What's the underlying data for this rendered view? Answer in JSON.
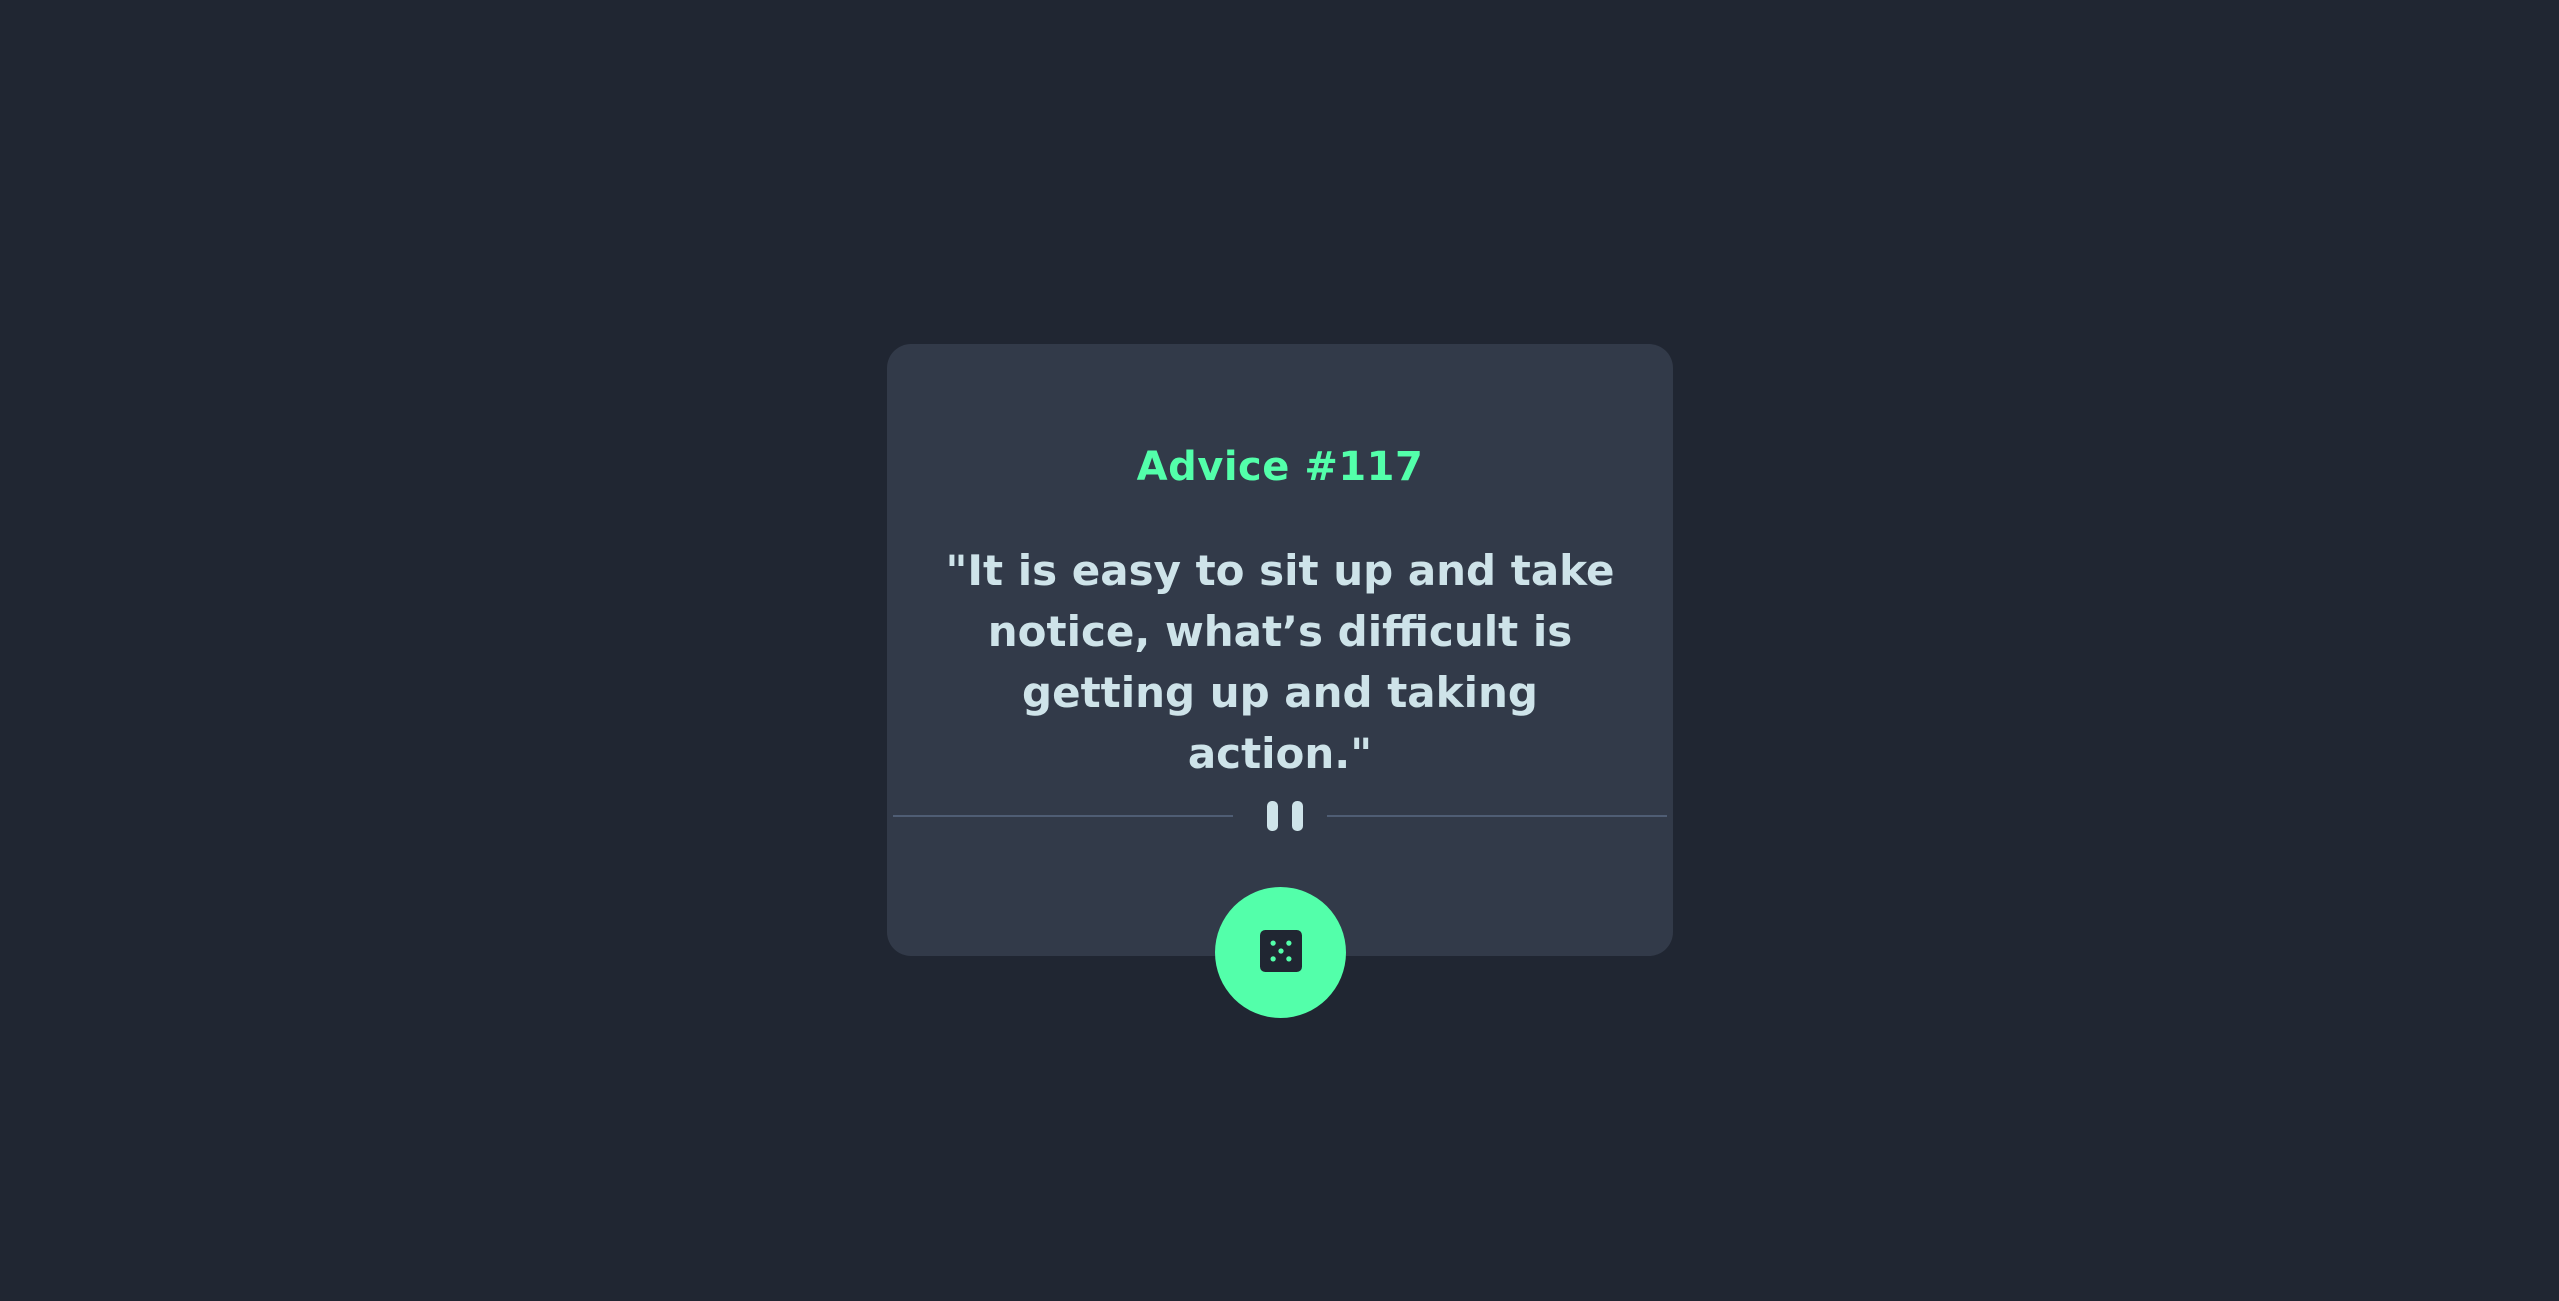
{
  "advice": {
    "number_label": "Advice #117",
    "quote": "\"It is easy to sit up and take notice, what’s difficult is getting up and taking action.\""
  },
  "divider": {
    "icon": "pause-icon"
  },
  "button": {
    "icon": "dice-icon"
  },
  "colors": {
    "background": "#202632",
    "card": "#323a49",
    "accent": "#53ffaa",
    "text": "#cee3e9",
    "divider": "#4f5d74"
  }
}
